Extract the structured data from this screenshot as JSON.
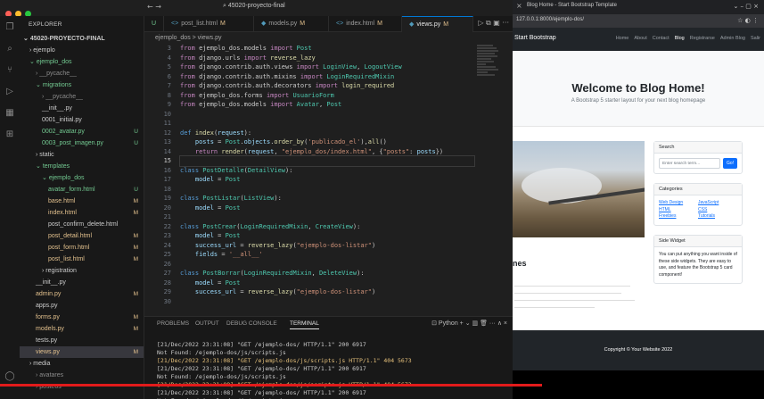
{
  "window": {
    "title": "45020-proyecto-final"
  },
  "colors": {
    "accent": "#0078d4",
    "modified": "#e2c08d",
    "untracked": "#73c991",
    "progress": "#e21b1b",
    "bootstrap_primary": "#0d6efd"
  },
  "activity_icons": [
    "files-icon",
    "search-icon",
    "source-control-icon",
    "run-debug-icon",
    "extensions-icon",
    "remote-icon"
  ],
  "explorer": {
    "header": "EXPLORER",
    "tree": [
      {
        "label": "45020-PROYECTO-FINAL",
        "indent": 0,
        "chevron": "v",
        "bold": true
      },
      {
        "label": "ejemplo",
        "indent": 1,
        "chevron": ">",
        "badge": ""
      },
      {
        "label": "ejemplo_dos",
        "indent": 1,
        "chevron": "v",
        "badge": "",
        "color": "green"
      },
      {
        "label": "__pycache__",
        "indent": 2,
        "chevron": ">",
        "badge": "",
        "color": "grey"
      },
      {
        "label": "migrations",
        "indent": 2,
        "chevron": "v",
        "badge": "",
        "color": "green"
      },
      {
        "label": "__pycache__",
        "indent": 3,
        "chevron": ">",
        "badge": "",
        "color": "grey"
      },
      {
        "label": "__init__.py",
        "indent": 3,
        "badge": ""
      },
      {
        "label": "0001_initial.py",
        "indent": 3,
        "badge": ""
      },
      {
        "label": "0002_avatar.py",
        "indent": 3,
        "badge": "U",
        "color": "green"
      },
      {
        "label": "0003_post_imagen.py",
        "indent": 3,
        "badge": "U",
        "color": "green"
      },
      {
        "label": "static",
        "indent": 2,
        "chevron": ">",
        "badge": ""
      },
      {
        "label": "templates",
        "indent": 2,
        "chevron": "v",
        "badge": "",
        "color": "green"
      },
      {
        "label": "ejemplo_dos",
        "indent": 3,
        "chevron": "v",
        "badge": "",
        "color": "green"
      },
      {
        "label": "avatar_form.html",
        "indent": 4,
        "badge": "U",
        "color": "green"
      },
      {
        "label": "base.html",
        "indent": 4,
        "badge": "M",
        "color": "orange"
      },
      {
        "label": "index.html",
        "indent": 4,
        "badge": "M",
        "color": "orange"
      },
      {
        "label": "post_confirm_delete.html",
        "indent": 4,
        "badge": ""
      },
      {
        "label": "post_detail.html",
        "indent": 4,
        "badge": "M",
        "color": "orange"
      },
      {
        "label": "post_form.html",
        "indent": 4,
        "badge": "M",
        "color": "orange"
      },
      {
        "label": "post_list.html",
        "indent": 4,
        "badge": "M",
        "color": "orange"
      },
      {
        "label": "registration",
        "indent": 3,
        "chevron": ">",
        "badge": ""
      },
      {
        "label": "__init__.py",
        "indent": 2,
        "badge": ""
      },
      {
        "label": "admin.py",
        "indent": 2,
        "badge": "M",
        "color": "orange"
      },
      {
        "label": "apps.py",
        "indent": 2,
        "badge": ""
      },
      {
        "label": "forms.py",
        "indent": 2,
        "badge": "M",
        "color": "orange"
      },
      {
        "label": "models.py",
        "indent": 2,
        "badge": "M",
        "color": "orange"
      },
      {
        "label": "tests.py",
        "indent": 2,
        "badge": ""
      },
      {
        "label": "views.py",
        "indent": 2,
        "badge": "M",
        "color": "orange",
        "selected": true
      },
      {
        "label": "media",
        "indent": 1,
        "chevron": ">",
        "badge": ""
      },
      {
        "label": "avatares",
        "indent": 2,
        "chevron": ">",
        "badge": "",
        "color": "grey"
      },
      {
        "label": "posteos",
        "indent": 2,
        "chevron": ">",
        "badge": "",
        "color": "grey"
      }
    ]
  },
  "editor_tabs": [
    {
      "label": "U"
    },
    {
      "label": "post_list.html",
      "badge": "M"
    },
    {
      "label": "models.py",
      "badge": "M"
    },
    {
      "label": "index.html",
      "badge": "M"
    },
    {
      "label": "views.py",
      "badge": "M",
      "active": true
    }
  ],
  "breadcrumb": "ejemplo_dos > views.py",
  "line_numbers": [
    "3",
    "4",
    "5",
    "6",
    "7",
    "8",
    "9",
    "10",
    "11",
    "12",
    "13",
    "14",
    "15",
    "16",
    "17",
    "18",
    "19",
    "20",
    "21",
    "22",
    "23",
    "24",
    "25",
    "26",
    "27",
    "28",
    "29",
    "30"
  ],
  "current_line": "15",
  "code_lines": [
    [
      [
        "kp",
        "from "
      ],
      [
        "t",
        "ejemplo_dos.models "
      ],
      [
        "kp",
        "import "
      ],
      [
        "cls",
        "Post"
      ]
    ],
    [
      [
        "kp",
        "from "
      ],
      [
        "t",
        "django.urls "
      ],
      [
        "kp",
        "import "
      ],
      [
        "fn",
        "reverse_lazy"
      ]
    ],
    [
      [
        "kp",
        "from "
      ],
      [
        "t",
        "django.contrib.auth.views "
      ],
      [
        "kp",
        "import "
      ],
      [
        "cls",
        "LoginView"
      ],
      [
        "t",
        ", "
      ],
      [
        "cls",
        "LogoutView"
      ]
    ],
    [
      [
        "kp",
        "from "
      ],
      [
        "t",
        "django.contrib.auth.mixins "
      ],
      [
        "kp",
        "import "
      ],
      [
        "cls",
        "LoginRequiredMixin"
      ]
    ],
    [
      [
        "kp",
        "from "
      ],
      [
        "t",
        "django.contrib.auth.decorators "
      ],
      [
        "kp",
        "import "
      ],
      [
        "fn",
        "login_required"
      ]
    ],
    [
      [
        "kp",
        "from "
      ],
      [
        "t",
        "ejemplo_dos.forms "
      ],
      [
        "kp",
        "import "
      ],
      [
        "cls",
        "UsuarioForm"
      ]
    ],
    [
      [
        "kp",
        "from "
      ],
      [
        "t",
        "ejemplo_dos.models "
      ],
      [
        "kp",
        "import "
      ],
      [
        "cls",
        "Avatar"
      ],
      [
        "t",
        ", "
      ],
      [
        "cls",
        "Post"
      ]
    ],
    [],
    [],
    [
      [
        "kw",
        "def "
      ],
      [
        "fn",
        "index"
      ],
      [
        "t",
        "("
      ],
      [
        "var",
        "request"
      ],
      [
        "t",
        "):"
      ]
    ],
    [
      [
        "t",
        "    "
      ],
      [
        "var",
        "posts"
      ],
      [
        "t",
        " = "
      ],
      [
        "cls",
        "Post"
      ],
      [
        "t",
        "."
      ],
      [
        "var",
        "objects"
      ],
      [
        "t",
        "."
      ],
      [
        "fn",
        "order_by"
      ],
      [
        "t",
        "("
      ],
      [
        "str",
        "'publicado_el'"
      ],
      [
        "t",
        "),"
      ],
      [
        "fn",
        "all"
      ],
      [
        "t",
        "()"
      ]
    ],
    [
      [
        "t",
        "    "
      ],
      [
        "kp",
        "return "
      ],
      [
        "fn",
        "render"
      ],
      [
        "t",
        "("
      ],
      [
        "var",
        "request"
      ],
      [
        "t",
        ", "
      ],
      [
        "str",
        "\"ejemplo_dos/index.html\""
      ],
      [
        "t",
        ", {"
      ],
      [
        "str",
        "\"posts\""
      ],
      [
        "t",
        ": "
      ],
      [
        "var",
        "posts"
      ],
      [
        "t",
        "})"
      ]
    ],
    [],
    [
      [
        "kw",
        "class "
      ],
      [
        "cls",
        "PostDetalle"
      ],
      [
        "t",
        "("
      ],
      [
        "cls",
        "DetailView"
      ],
      [
        "t",
        "):"
      ]
    ],
    [
      [
        "t",
        "    "
      ],
      [
        "var",
        "model"
      ],
      [
        "t",
        " = "
      ],
      [
        "cls",
        "Post"
      ]
    ],
    [],
    [
      [
        "kw",
        "class "
      ],
      [
        "cls",
        "PostListar"
      ],
      [
        "t",
        "("
      ],
      [
        "cls",
        "ListView"
      ],
      [
        "t",
        "):"
      ]
    ],
    [
      [
        "t",
        "    "
      ],
      [
        "var",
        "model"
      ],
      [
        "t",
        " = "
      ],
      [
        "cls",
        "Post"
      ]
    ],
    [],
    [
      [
        "kw",
        "class "
      ],
      [
        "cls",
        "PostCrear"
      ],
      [
        "t",
        "("
      ],
      [
        "cls",
        "LoginRequiredMixin"
      ],
      [
        "t",
        ", "
      ],
      [
        "cls",
        "CreateView"
      ],
      [
        "t",
        "):"
      ]
    ],
    [
      [
        "t",
        "    "
      ],
      [
        "var",
        "model"
      ],
      [
        "t",
        " = "
      ],
      [
        "cls",
        "Post"
      ]
    ],
    [
      [
        "t",
        "    "
      ],
      [
        "var",
        "success_url"
      ],
      [
        "t",
        " = "
      ],
      [
        "fn",
        "reverse_lazy"
      ],
      [
        "t",
        "("
      ],
      [
        "str",
        "\"ejemplo-dos-listar\""
      ],
      [
        "t",
        ")"
      ]
    ],
    [
      [
        "t",
        "    "
      ],
      [
        "var",
        "fields"
      ],
      [
        "t",
        " = "
      ],
      [
        "str",
        "'__all__'"
      ]
    ],
    [],
    [
      [
        "kw",
        "class "
      ],
      [
        "cls",
        "PostBorrar"
      ],
      [
        "t",
        "("
      ],
      [
        "cls",
        "LoginRequiredMixin"
      ],
      [
        "t",
        ", "
      ],
      [
        "cls",
        "DeleteView"
      ],
      [
        "t",
        "):"
      ]
    ],
    [
      [
        "t",
        "    "
      ],
      [
        "var",
        "model"
      ],
      [
        "t",
        " = "
      ],
      [
        "cls",
        "Post"
      ]
    ],
    [
      [
        "t",
        "    "
      ],
      [
        "var",
        "success_url"
      ],
      [
        "t",
        " = "
      ],
      [
        "fn",
        "reverse_lazy"
      ],
      [
        "t",
        "("
      ],
      [
        "str",
        "\"ejemplo-dos-listar\""
      ],
      [
        "t",
        ")"
      ]
    ],
    []
  ],
  "panel": {
    "tabs": [
      "PROBLEMS",
      "OUTPUT",
      "DEBUG CONSOLE",
      "TERMINAL"
    ],
    "active_tab": "TERMINAL",
    "shell": "Python",
    "terminal_lines": [
      {
        "text": "[21/Dec/2022 23:31:08] \"GET /ejemplo-dos/ HTTP/1.1\" 200 6917",
        "warn": false
      },
      {
        "text": "Not Found: /ejemplo-dos/js/scripts.js",
        "warn": false
      },
      {
        "text": "[21/Dec/2022 23:31:08] \"GET /ejemplo-dos/js/scripts.js HTTP/1.1\" 404 5673",
        "warn": true
      },
      {
        "text": "[21/Dec/2022 23:31:08] \"GET /ejemplo-dos/ HTTP/1.1\" 200 6917",
        "warn": false
      },
      {
        "text": "Not Found: /ejemplo-dos/js/scripts.js",
        "warn": false
      },
      {
        "text": "[21/Dec/2022 23:31:08] \"GET /ejemplo-dos/js/scripts.js HTTP/1.1\" 404 5673",
        "warn": true
      },
      {
        "text": "[21/Dec/2022 23:31:08] \"GET /ejemplo-dos/ HTTP/1.1\" 200 6917",
        "warn": false
      },
      {
        "text": "Not Found: /ejemplo-dos/js/scripts.js",
        "warn": false
      }
    ]
  },
  "browser": {
    "tab_title": "Blog Home - Start Bootstrap Template",
    "url": "127.0.0.1:8000/ejemplo-dos/",
    "brand": "Start Bootstrap",
    "nav_links": [
      "Home",
      "About",
      "Contact",
      "Blog",
      "Registrarse",
      "Admin Blog",
      "Salir"
    ],
    "active_link": "Blog",
    "hero_title": "Welcome to Blog Home!",
    "hero_subtitle": "A Bootstrap 5 starter layout for your next blog homepage",
    "post_partial_title": "nes",
    "search": {
      "title": "Search",
      "placeholder": "Enter search term...",
      "button": "Go!"
    },
    "categories": {
      "title": "Categories",
      "col1": [
        "Web Design",
        "HTML",
        "Freebies"
      ],
      "col2": [
        "JavaScript",
        "CSS",
        "Tutorials"
      ]
    },
    "side_widget": {
      "title": "Side Widget",
      "text": "You can put anything you want inside of these side widgets. They are easy to use, and feature the Bootstrap 5 card component!"
    },
    "footer": "Copyright © Your Website 2022"
  },
  "video_progress": 0.71
}
